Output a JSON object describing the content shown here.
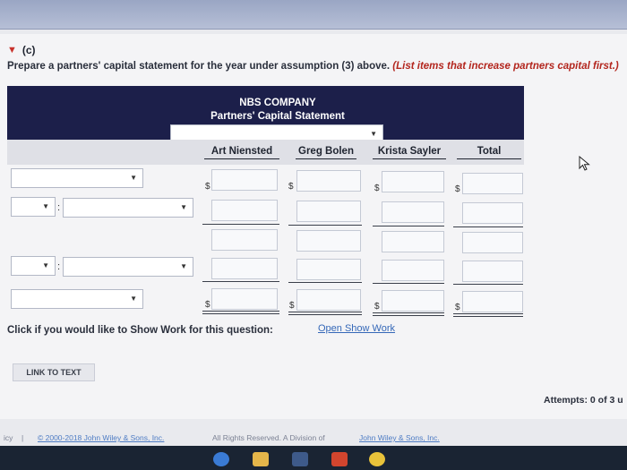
{
  "section": {
    "label": "(c)",
    "instruction": "Prepare a partners' capital statement for the year under assumption (3) above.",
    "hint": "(List items that increase partners capital first.)"
  },
  "statement": {
    "company": "NBS COMPANY",
    "title": "Partners' Capital Statement",
    "period_value": "",
    "columns": [
      "Art Niensted",
      "Greg Bolen",
      "Krista Sayler",
      "Total"
    ]
  },
  "rows": {
    "dollar": "$",
    "colon": ":"
  },
  "show_work": {
    "prompt": "Click if you would like to Show Work for this question:",
    "link": "Open Show Work"
  },
  "link_to_text": "LINK TO TEXT",
  "attempts": "Attempts: 0 of 3 u",
  "footer": {
    "left": "icy",
    "sep": "|",
    "copyright": "© 2000-2018 John Wiley & Sons, Inc.",
    "rights": "All Rights Reserved. A Division of",
    "company_link": "John Wiley & Sons, Inc."
  },
  "colors": {
    "header": "#1c1f4a",
    "accent": "#b3261e",
    "link": "#3568b8"
  }
}
